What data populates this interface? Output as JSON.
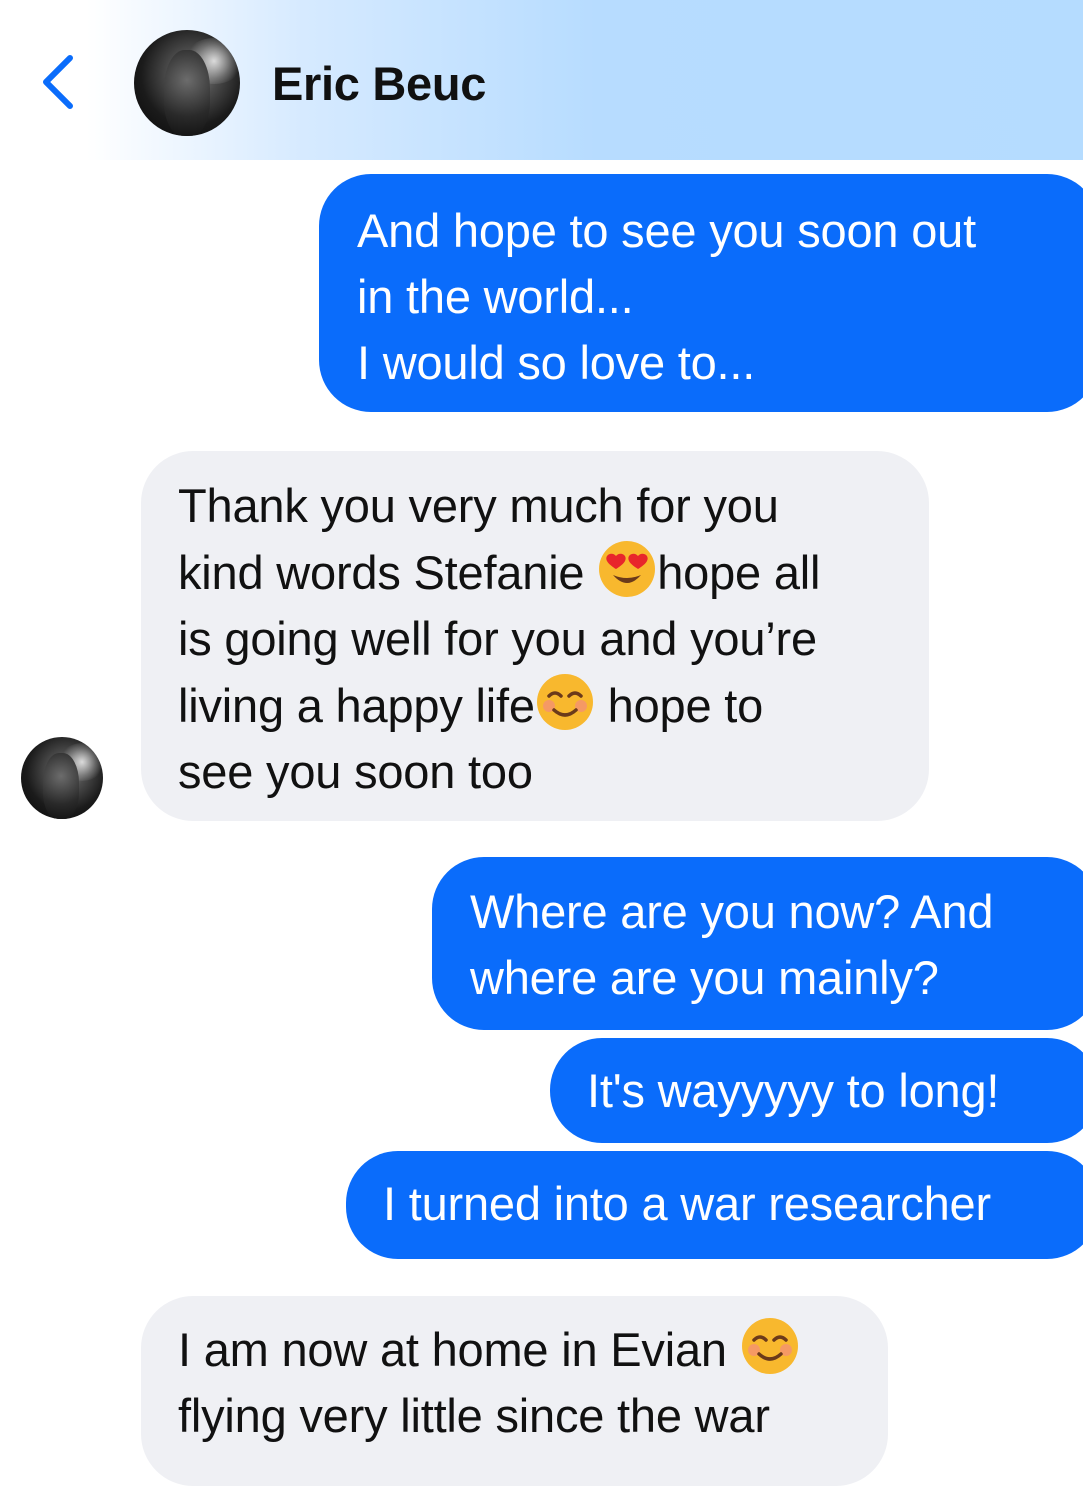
{
  "header": {
    "back_icon": "chevron-left-icon",
    "contact_name": "Eric Beuc",
    "colors": {
      "gradient_start": "#ffffff",
      "gradient_end": "#b5dcff",
      "accent": "#0a6cfb"
    }
  },
  "colors": {
    "sent_bubble": "#0a6cfb",
    "received_bubble": "#eff0f4"
  },
  "messages": [
    {
      "direction": "sent",
      "lines": [
        "And hope to see you soon out",
        "in the world...",
        "I would so love to..."
      ]
    },
    {
      "direction": "received",
      "lines": [
        "Thank you very much for you",
        "kind words Stefanie",
        "hope all",
        "is going well for you and you’re",
        "living a happy life",
        "hope to",
        "see you soon too"
      ],
      "emojis": [
        "heart-eyes-emoji",
        "smiling-face-emoji"
      ]
    },
    {
      "direction": "sent",
      "lines": [
        "Where are you now? And",
        "where are you mainly?"
      ]
    },
    {
      "direction": "sent",
      "lines": [
        "It's wayyyyy to long!"
      ]
    },
    {
      "direction": "sent",
      "lines": [
        "I turned into a war researcher"
      ]
    },
    {
      "direction": "received",
      "lines": [
        "I am now at home in Evian",
        "flying very little since the war"
      ],
      "emojis": [
        "smiling-face-emoji"
      ]
    }
  ]
}
